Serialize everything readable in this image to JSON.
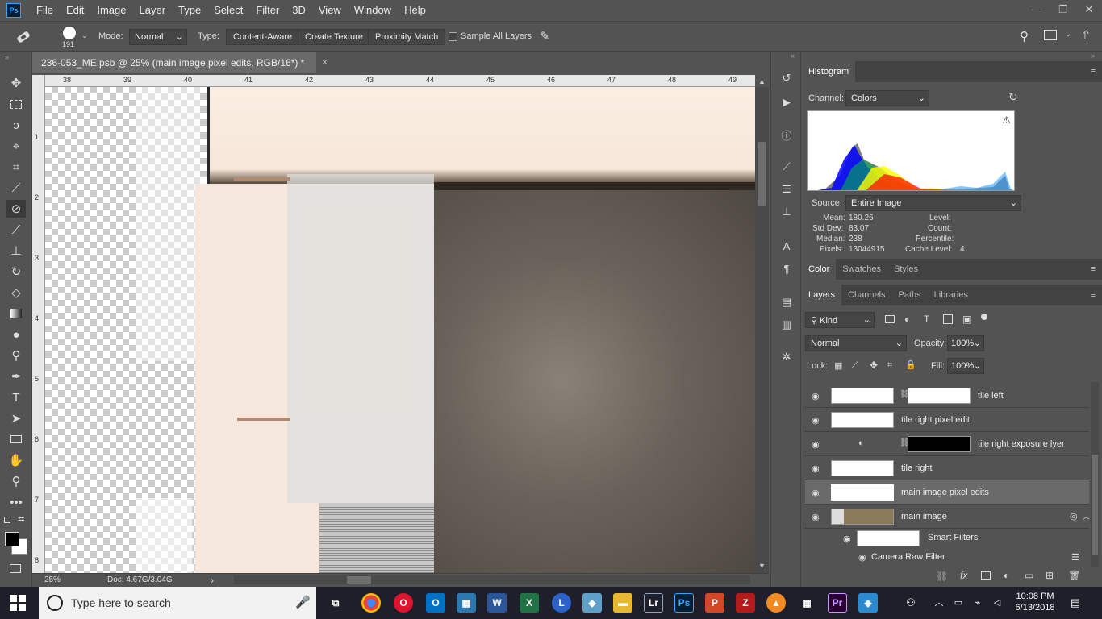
{
  "app": {
    "logo": "Ps"
  },
  "menu": [
    "File",
    "Edit",
    "Image",
    "Layer",
    "Type",
    "Select",
    "Filter",
    "3D",
    "View",
    "Window",
    "Help"
  ],
  "window_controls": {
    "minimize": "—",
    "restore": "❐",
    "close": "✕"
  },
  "options": {
    "brush_size": "191",
    "mode_label": "Mode:",
    "mode_value": "Normal",
    "type_label": "Type:",
    "type_buttons": [
      "Content-Aware",
      "Create Texture",
      "Proximity Match"
    ],
    "sample_all_label": "Sample All Layers"
  },
  "document": {
    "tab_title": "236-053_ME.psb @ 25% (main image pixel edits, RGB/16*) *",
    "close": "×",
    "ruler_h": [
      "38",
      "39",
      "40",
      "41",
      "42",
      "43",
      "44",
      "45",
      "46",
      "47",
      "48",
      "49"
    ],
    "ruler_v": [
      "1",
      "2",
      "3",
      "4",
      "5",
      "6",
      "7",
      "8"
    ]
  },
  "status": {
    "zoom": "25%",
    "doc": "Doc: 4.67G/3.04G",
    "arrow": "›"
  },
  "histogram": {
    "tab": "Histogram",
    "channel_label": "Channel:",
    "channel_value": "Colors",
    "source_label": "Source:",
    "source_value": "Entire Image",
    "mean_label": "Mean:",
    "mean": "180.26",
    "stddev_label": "Std Dev:",
    "stddev": "83.07",
    "median_label": "Median:",
    "median": "238",
    "pixels_label": "Pixels:",
    "pixels": "13044915",
    "level_label": "Level:",
    "count_label": "Count:",
    "percentile_label": "Percentile:",
    "cache_label": "Cache Level:",
    "cache": "4"
  },
  "color_panel_tabs": [
    "Color",
    "Swatches",
    "Styles"
  ],
  "layers_panel": {
    "tabs": [
      "Layers",
      "Channels",
      "Paths",
      "Libraries"
    ],
    "filter_kind": "Kind",
    "blend_mode": "Normal",
    "opacity_label": "Opacity:",
    "opacity": "100%",
    "lock_label": "Lock:",
    "fill_label": "Fill:",
    "fill": "100%",
    "layers": [
      {
        "name": "tile left"
      },
      {
        "name": "tile right pixel edit"
      },
      {
        "name": "tile right exposure lyer"
      },
      {
        "name": "tile right"
      },
      {
        "name": "main image pixel edits"
      },
      {
        "name": "main image"
      }
    ],
    "smart_filters": "Smart Filters",
    "camera_raw": "Camera Raw Filter",
    "footer_fx": "fx"
  },
  "taskbar": {
    "search_placeholder": "Type here to search",
    "time": "10:08 PM",
    "date": "6/13/2018",
    "apps": [
      {
        "label": "Lr",
        "color": "#0b2537"
      },
      {
        "label": "Ps",
        "color": "#001e36"
      },
      {
        "label": "Pr",
        "color": "#2a0034"
      }
    ]
  },
  "colors": {
    "accent": "#31a8ff",
    "panel_bg": "#535353",
    "selected_layer": "#6a6a6a"
  }
}
